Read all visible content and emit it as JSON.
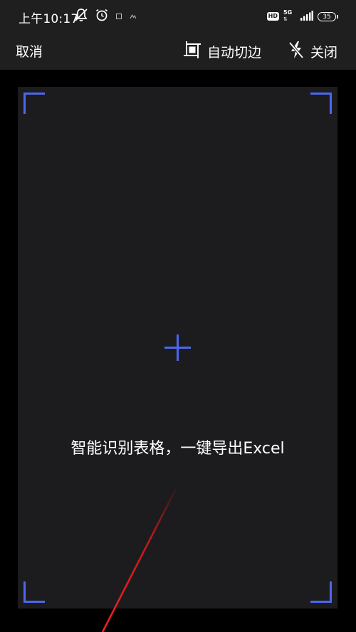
{
  "status_bar": {
    "time": "上午10:17",
    "hd": "HD",
    "network": "5G",
    "battery": "35",
    "icons": [
      "mute-icon",
      "alarm-icon",
      "notification-icon",
      "notification-icon-2",
      "signal-icon"
    ]
  },
  "toolbar": {
    "cancel_label": "取消",
    "auto_crop_label": "自动切边",
    "flash_label": "关闭"
  },
  "viewfinder": {
    "hint": "智能识别表格，一键导出Excel",
    "accent_color": "#4d66ee"
  }
}
